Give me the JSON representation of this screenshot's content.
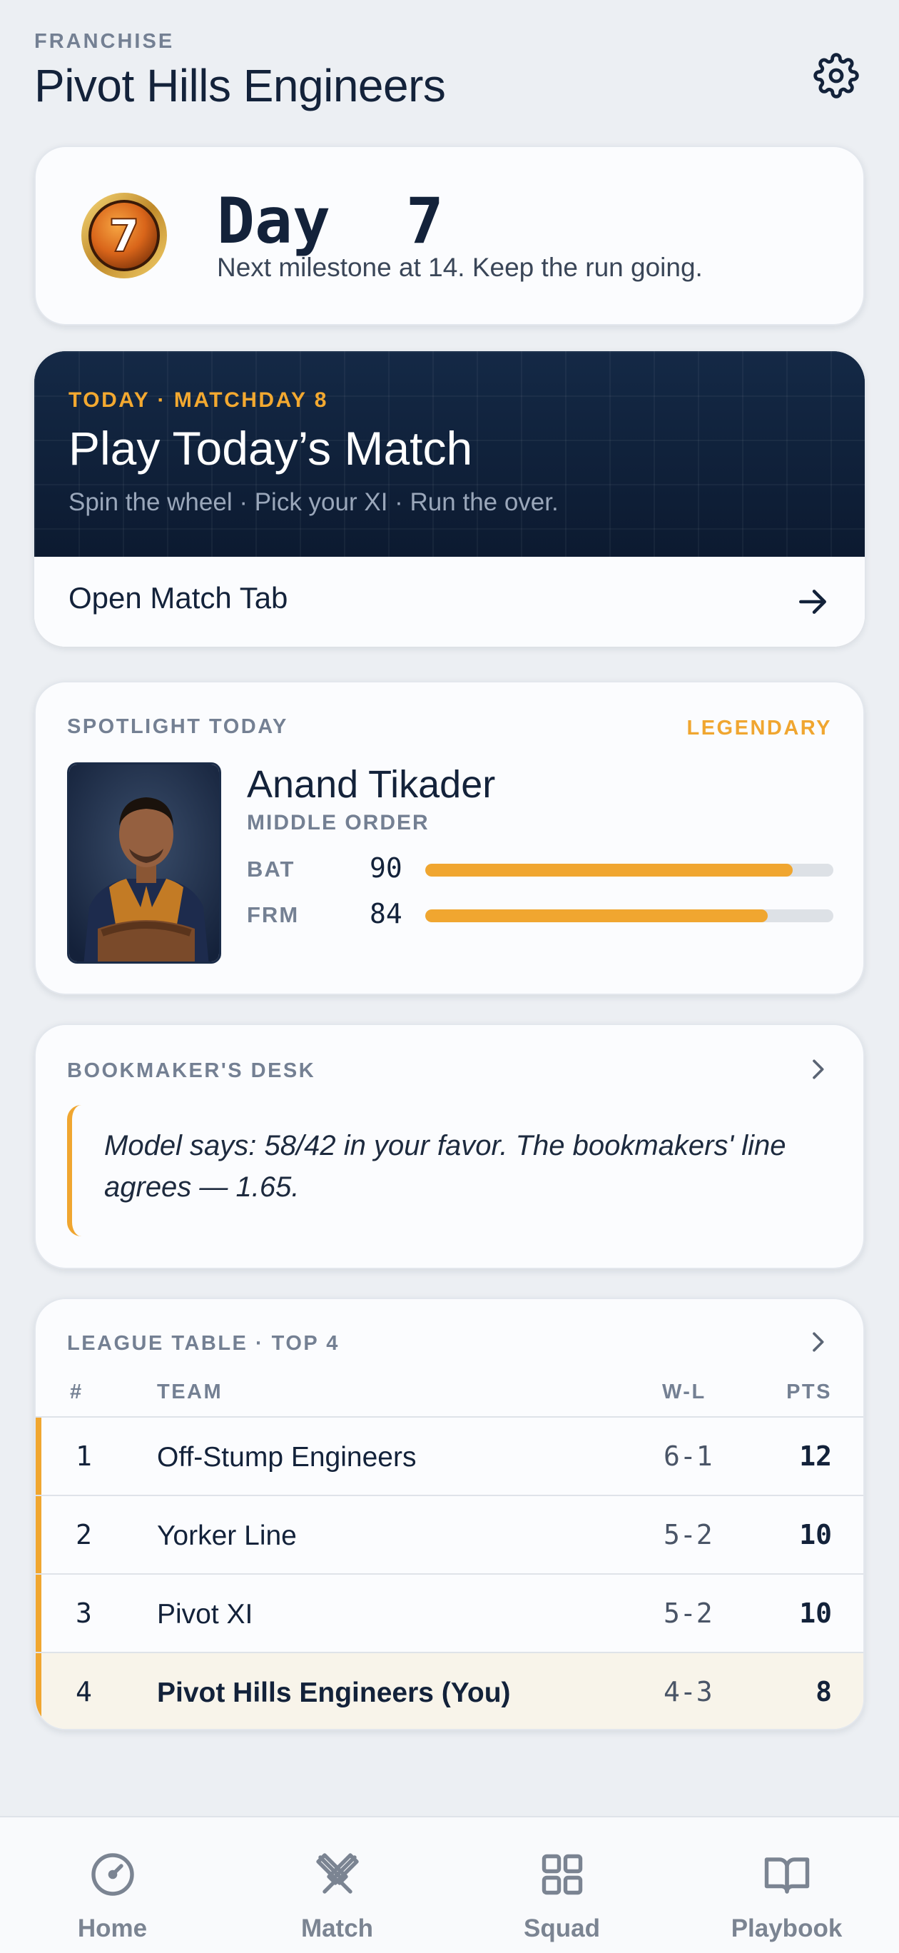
{
  "header": {
    "eyebrow": "FRANCHISE",
    "title": "Pivot Hills Engineers",
    "settings_icon": "gear-icon"
  },
  "streak": {
    "badge_number": "7",
    "title": "Day  7",
    "subtitle": "Next milestone at 14. Keep the run going."
  },
  "match": {
    "eyebrow": "TODAY · MATCHDAY 8",
    "title": "Play Today’s Match",
    "subtitle": "Spin the wheel · Pick your XI · Run the over.",
    "cta_label": "Open Match Tab"
  },
  "spotlight": {
    "section_label": "SPOTLIGHT TODAY",
    "rarity": "LEGENDARY",
    "player_name": "Anand Tikader",
    "role": "MIDDLE ORDER",
    "stats": [
      {
        "label": "BAT",
        "value": "90",
        "fill": 0.9
      },
      {
        "label": "FRM",
        "value": "84",
        "fill": 0.84
      }
    ]
  },
  "bookmaker": {
    "section_label": "BOOKMAKER'S DESK",
    "quote": "Model says: 58/42 in your favor. The bookmakers' line agrees — 1.65."
  },
  "league": {
    "section_label": "LEAGUE TABLE · TOP 4",
    "headers": {
      "rank": "#",
      "team": "TEAM",
      "wl": "W-L",
      "pts": "PTS"
    },
    "rows": [
      {
        "rank": "1",
        "team": "Off-Stump Engineers",
        "wl": "6-1",
        "pts": "12"
      },
      {
        "rank": "2",
        "team": "Yorker Line",
        "wl": "5-2",
        "pts": "10"
      },
      {
        "rank": "3",
        "team": "Pivot XI",
        "wl": "5-2",
        "pts": "10"
      },
      {
        "rank": "4",
        "team": "Pivot Hills Engineers (You)",
        "wl": "4-3",
        "pts": "8"
      }
    ]
  },
  "nav": {
    "items": [
      {
        "label": "Home",
        "icon": "gauge-icon"
      },
      {
        "label": "Match",
        "icon": "crossed-bats-icon"
      },
      {
        "label": "Squad",
        "icon": "grid-icon"
      },
      {
        "label": "Playbook",
        "icon": "open-book-icon"
      }
    ]
  },
  "colors": {
    "accent": "#f0a630",
    "navy": "#13223a",
    "background": "#eceff3"
  }
}
